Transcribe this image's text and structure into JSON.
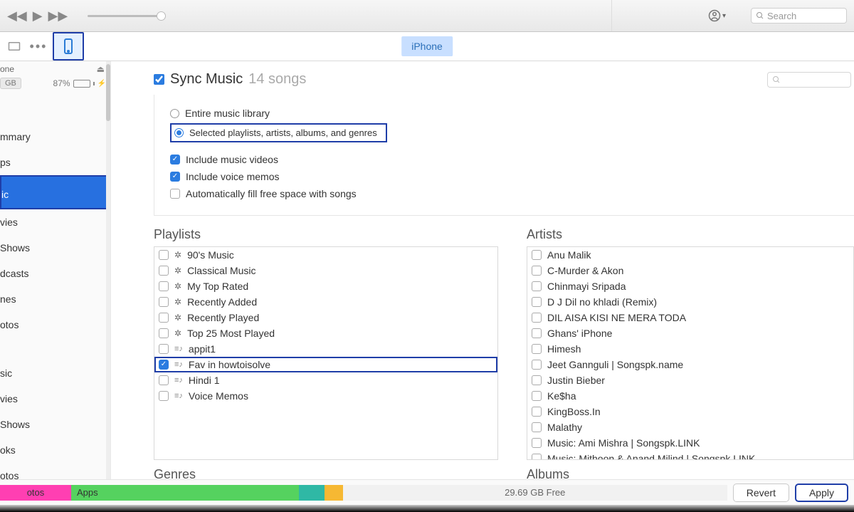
{
  "toolbar": {
    "search_placeholder": "Search",
    "device_tab_label": "iPhone"
  },
  "device": {
    "name": "one",
    "capacity": "GB",
    "battery_pct": "87%"
  },
  "sidebar": {
    "settings": [
      "mmary",
      "ps",
      "ic",
      "vies",
      "Shows",
      "dcasts",
      "nes",
      "otos"
    ],
    "ondevice": [
      "sic",
      "vies",
      "Shows",
      "oks",
      "otos"
    ],
    "selected_index": 2,
    "highlight_index": 2
  },
  "sync": {
    "title": "Sync Music",
    "count_label": "14 songs",
    "radio_entire": "Entire music library",
    "radio_selected": "Selected playlists, artists, albums, and genres",
    "chk_videos": "Include music videos",
    "chk_memos": "Include voice memos",
    "chk_fill": "Automatically fill free space with songs"
  },
  "playlists": {
    "title": "Playlists",
    "items": [
      {
        "label": "90's Music",
        "smart": true,
        "checked": false
      },
      {
        "label": "Classical Music",
        "smart": true,
        "checked": false
      },
      {
        "label": "My Top Rated",
        "smart": true,
        "checked": false
      },
      {
        "label": "Recently Added",
        "smart": true,
        "checked": false
      },
      {
        "label": "Recently Played",
        "smart": true,
        "checked": false
      },
      {
        "label": "Top 25 Most Played",
        "smart": true,
        "checked": false
      },
      {
        "label": "appit1",
        "smart": false,
        "checked": false
      },
      {
        "label": "Fav in howtoisolve",
        "smart": false,
        "checked": true,
        "hl": true
      },
      {
        "label": "Hindi 1",
        "smart": false,
        "checked": false
      },
      {
        "label": "Voice Memos",
        "smart": false,
        "checked": false
      }
    ]
  },
  "artists": {
    "title": "Artists",
    "items": [
      "Anu Malik",
      "C-Murder & Akon",
      "Chinmayi Sripada",
      "D J Dil no khladi (Remix)",
      "DIL AISA KISI NE MERA TODA",
      "Ghans' iPhone",
      "Himesh",
      "Jeet Gannguli | Songspk.name",
      "Justin Bieber",
      "Ke$ha",
      "KingBoss.In",
      "Malathy",
      "Music: Ami Mishra | Songspk.LINK",
      "Music: Mithoon & Anand Milind | Songspk.LINK"
    ]
  },
  "lower": {
    "genres": "Genres",
    "albums": "Albums"
  },
  "footer": {
    "seg_otos": "otos",
    "seg_apps": "Apps",
    "free_label": "29.69 GB Free",
    "revert": "Revert",
    "apply": "Apply"
  }
}
